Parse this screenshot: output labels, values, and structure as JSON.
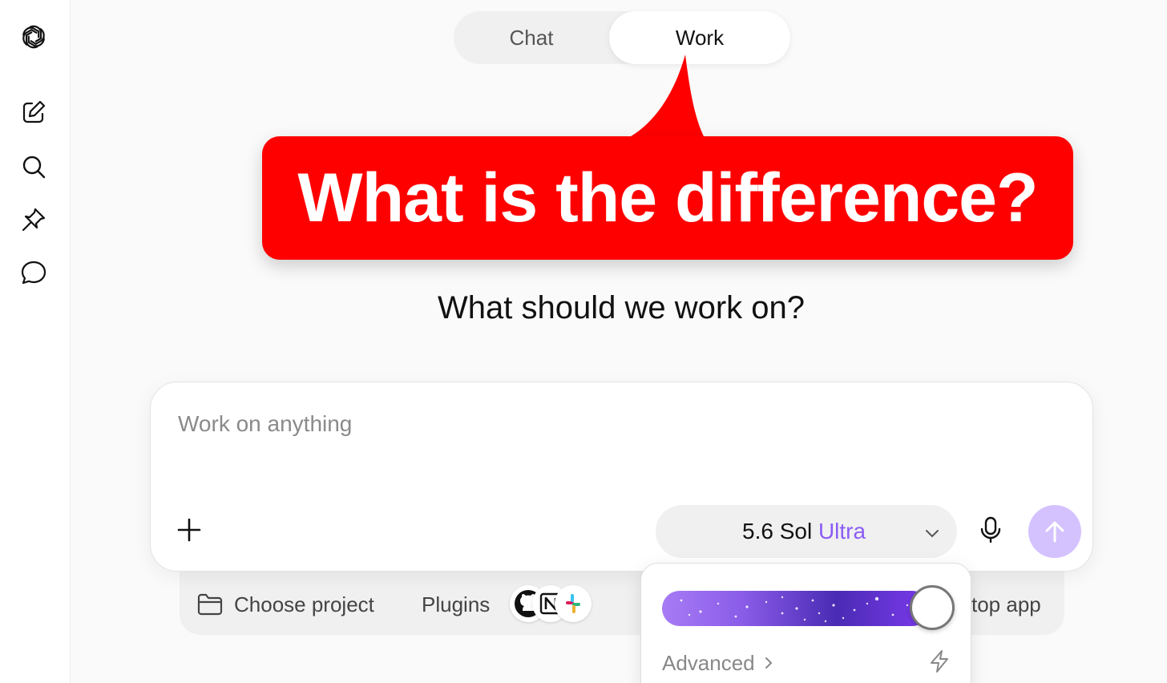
{
  "mode_toggle": {
    "tabs": [
      {
        "label": "Chat",
        "active": false
      },
      {
        "label": "Work",
        "active": true
      }
    ]
  },
  "callout": {
    "text": "What is the difference?",
    "color": "#ff0000"
  },
  "main": {
    "heading": "What should we work on?"
  },
  "composer": {
    "placeholder": "Work on anything",
    "value": "",
    "model": {
      "base": "5.6 Sol",
      "tier": "Ultra",
      "accent_color": "#8b5cf6"
    },
    "send_button_color": "#d4c2ff"
  },
  "tray": {
    "project_label": "Choose project",
    "plugins_label": "Plugins",
    "plugin_icons": [
      "github-icon",
      "notion-icon",
      "slack-icon"
    ],
    "desktop_app_label_visible": "top app"
  },
  "model_popover": {
    "intelligence_level": 1.0,
    "advanced_label": "Advanced"
  },
  "sidebar": {
    "icons": [
      "openai-logo-icon",
      "new-chat-icon",
      "search-icon",
      "pin-icon",
      "chat-bubble-icon"
    ]
  }
}
